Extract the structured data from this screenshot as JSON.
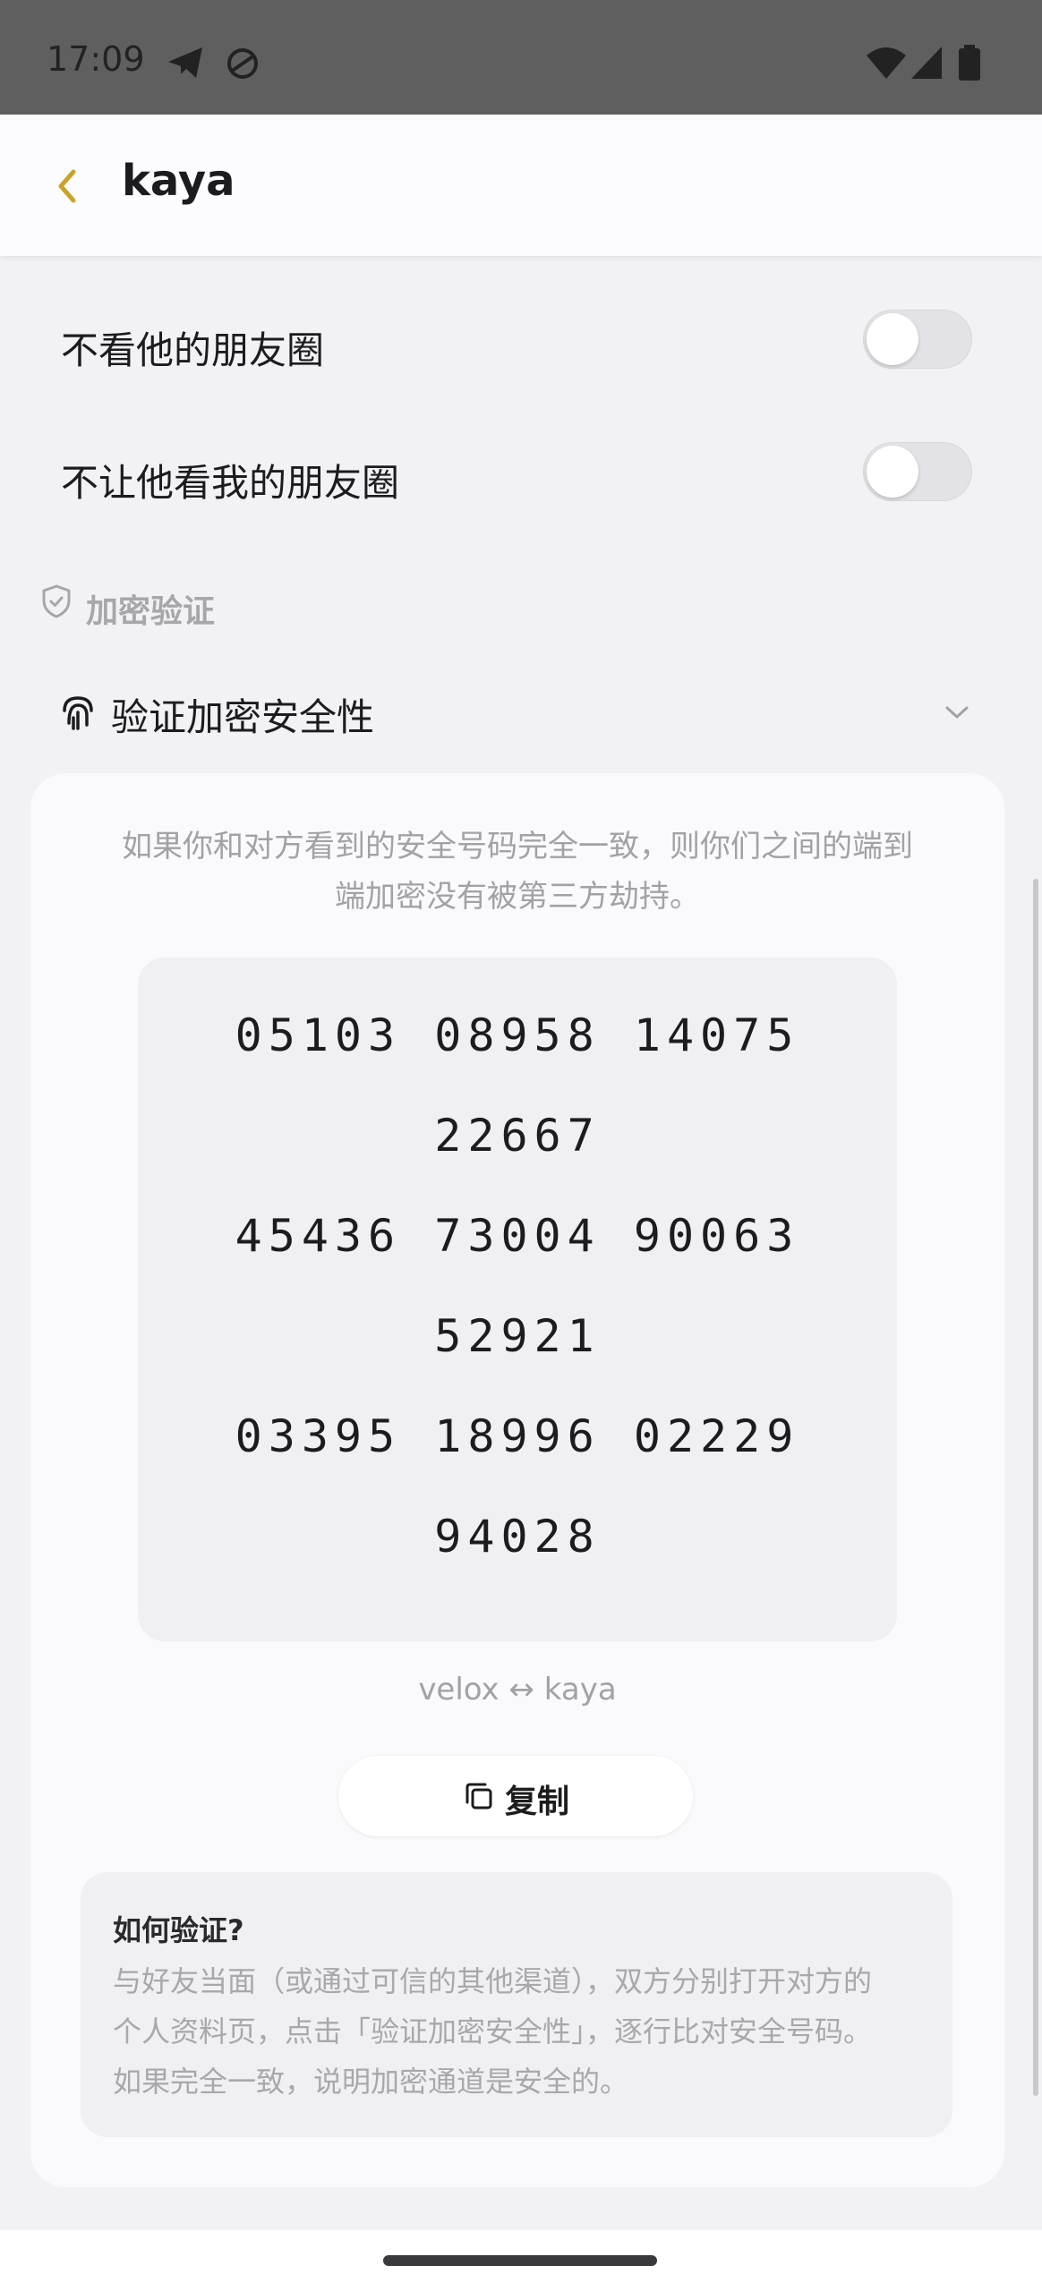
{
  "status_bar": {
    "time": "17:09"
  },
  "header": {
    "title": "kaya"
  },
  "settings": {
    "hide_their_moments": {
      "label": "不看他的朋友圈",
      "enabled": false
    },
    "hide_my_moments": {
      "label": "不让他看我的朋友圈",
      "enabled": false
    }
  },
  "encryption": {
    "section_label": "加密验证",
    "verify_label": "验证加密安全性",
    "intro_line1": "如果你和对方看到的安全号码完全一致，则你们之间的端到",
    "intro_line2": "端加密没有被第三方劫持。",
    "number_lines": [
      "05103 08958 14075",
      "22667",
      "45436 73004 90063",
      "52921",
      "03395 18996 02229",
      "94028"
    ],
    "pair": "velox ↔ kaya",
    "copy_label": "复制",
    "howto_title": "如何验证?",
    "howto_lines": [
      "与好友当面（或通过可信的其他渠道），双方分别打开对方的",
      "个人资料页，点击「验证加密安全性」，逐行比对安全号码。",
      "如果完全一致，说明加密通道是安全的。"
    ]
  },
  "colors": {
    "accent": "#c9a227",
    "background": "#f2f2f5",
    "card": "#fafafc"
  }
}
